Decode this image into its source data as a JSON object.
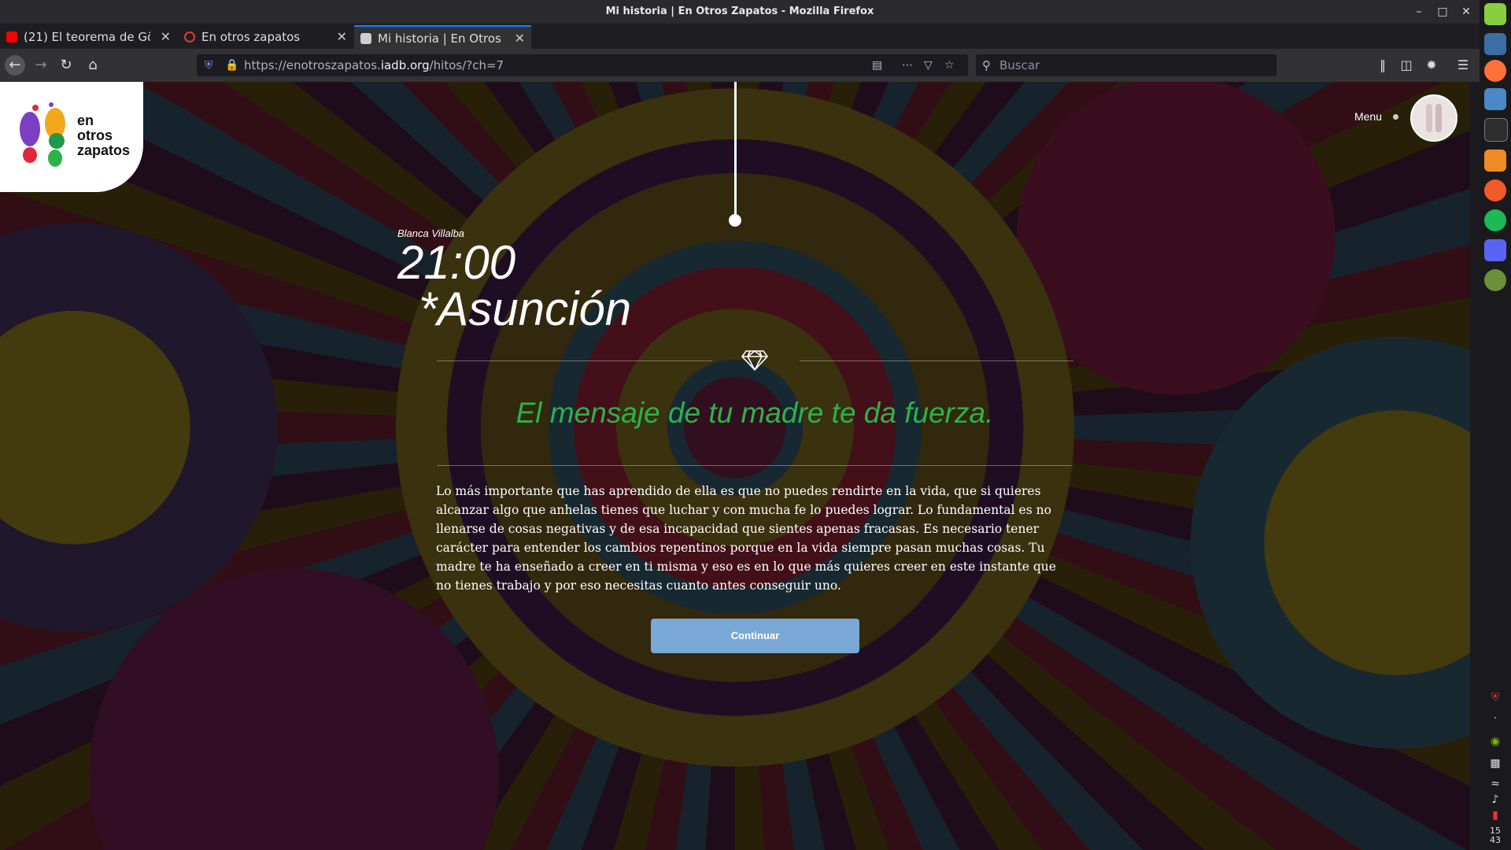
{
  "window": {
    "title": "Mi historia | En Otros Zapatos - Mozilla Firefox"
  },
  "tabs": [
    {
      "label": "(21) El teorema de Gö",
      "favicon_color": "#ff0000"
    },
    {
      "label": "En otros zapatos",
      "favicon_color": "#e03b2e"
    },
    {
      "label": "Mi historia | En Otros Z",
      "favicon_color": "#cfcfcf"
    }
  ],
  "url": {
    "prefix": "https://enotroszapatos.",
    "domain": "iadb.org",
    "path": "/hitos/?ch=7"
  },
  "search": {
    "placeholder": "Buscar"
  },
  "site": {
    "logo_lines": [
      "en",
      "otros",
      "zapatos"
    ],
    "menu_label": "Menu"
  },
  "story": {
    "author": "Blanca Villalba",
    "time": "21:00",
    "place": "*Asunción",
    "headline": "El mensaje de tu madre te da fuerza.",
    "body": "Lo más importante que has aprendido de ella es que no puedes rendirte en la vida, que si quieres alcanzar algo que anhelas tienes que luchar y con mucha fe lo puedes lograr. Lo fundamental es no llenarse de cosas negativas y de esa incapacidad que sientes apenas fracasas. Es necesario tener carácter para entender los cambios repentinos porque en la vida siempre pasan muchas cosas. Tu madre te ha enseñado a creer en ti misma y eso es en lo que más quieres creer en este instante que no tienes trabajo y por eso necesitas cuanto antes conseguir uno.",
    "cta": "Continuar"
  },
  "system": {
    "clock_hour": "15",
    "clock_min": "43"
  },
  "colors": {
    "accent_green": "#2bb34a",
    "button_blue": "#7aa8d6",
    "firefox_blue": "#0a84ff"
  }
}
